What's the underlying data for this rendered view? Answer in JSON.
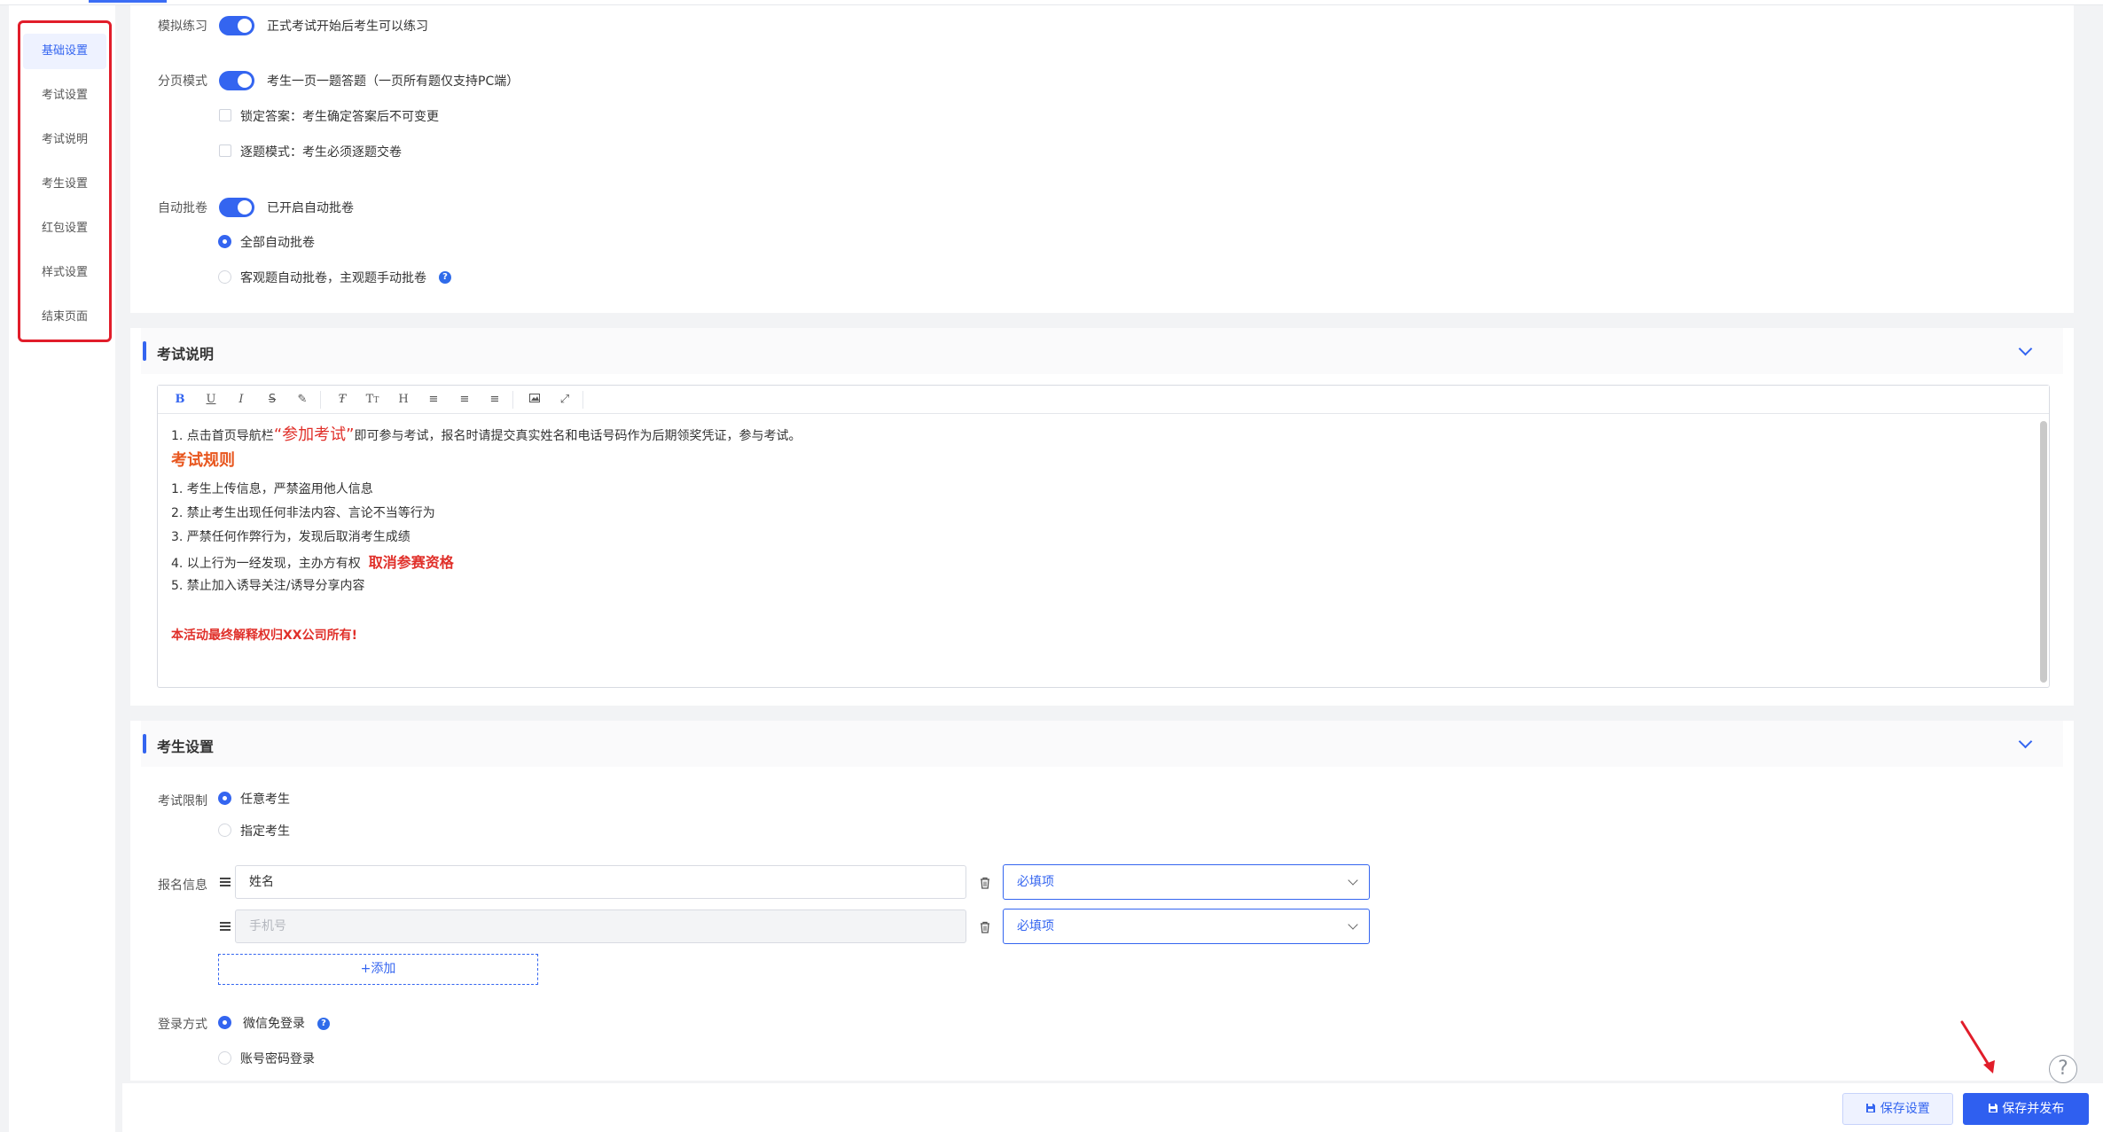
{
  "sidebar": {
    "items": [
      {
        "label": "基础设置"
      },
      {
        "label": "考试设置"
      },
      {
        "label": "考试说明"
      },
      {
        "label": "考生设置"
      },
      {
        "label": "红包设置"
      },
      {
        "label": "样式设置"
      },
      {
        "label": "结束页面"
      }
    ],
    "active_index": 0
  },
  "basic": {
    "practice": {
      "label": "模拟练习",
      "text": "正式考试开始后考生可以练习",
      "on": true
    },
    "paging": {
      "label": "分页模式",
      "text": "考生一页一题答题（一页所有题仅支持PC端）",
      "on": true,
      "options": [
        {
          "text": "锁定答案：考生确定答案后不可变更",
          "checked": false
        },
        {
          "text": "逐题模式：考生必须逐题交卷",
          "checked": false
        }
      ]
    },
    "auto_grade": {
      "label": "自动批卷",
      "text": "已开启自动批卷",
      "on": true,
      "options": [
        {
          "text": "全部自动批卷",
          "selected": true
        },
        {
          "text": "客观题自动批卷，主观题手动批卷",
          "selected": false
        }
      ]
    }
  },
  "exam_desc": {
    "title": "考试说明",
    "toolbar": [
      "bold",
      "underline",
      "italic",
      "strikethrough",
      "brush",
      "clear-format",
      "font-size",
      "heading",
      "align-left",
      "align-center",
      "align-right",
      "image",
      "fullscreen"
    ],
    "content": {
      "line1_pre": "1. 点击首页导航栏",
      "line1_highlight": "“参加考试”",
      "line1_post": "即可参与考试，报名时请提交真实姓名和电话号码作为后期领奖凭证，参与考试。",
      "rules_heading": "考试规则",
      "rule1": "1. 考生上传信息，严禁盗用他人信息",
      "rule2": "2. 禁止考生出现任何非法内容、言论不当等行为",
      "rule3": "3. 严禁任何作弊行为，发现后取消考生成绩",
      "rule4_pre": "4. 以上行为一经发现，主办方有权",
      "rule4_highlight": "取消参赛资格",
      "rule5": "5. 禁止加入诱导关注/诱导分享内容",
      "footer": "本活动最终解释权归XX公司所有!"
    }
  },
  "candidate": {
    "title": "考生设置",
    "limit": {
      "label": "考试限制",
      "options": [
        {
          "text": "任意考生",
          "selected": true
        },
        {
          "text": "指定考生",
          "selected": false
        }
      ]
    },
    "signup": {
      "label": "报名信息",
      "fields": [
        {
          "value": "姓名",
          "requirement": "必填项",
          "disabled": false
        },
        {
          "value": "手机号",
          "requirement": "必填项",
          "disabled": true
        }
      ],
      "add_label": "+添加"
    },
    "login": {
      "label": "登录方式",
      "options": [
        {
          "text": "微信免登录",
          "selected": true
        },
        {
          "text": "账号密码登录",
          "selected": false
        }
      ]
    }
  },
  "actions": {
    "save": "保存设置",
    "publish": "保存并发布",
    "help": "?"
  },
  "colors": {
    "accent": "#3465f0",
    "highlight_border": "#e11d2a",
    "text_red": "#e0302a",
    "text_orange": "#e8561e"
  }
}
